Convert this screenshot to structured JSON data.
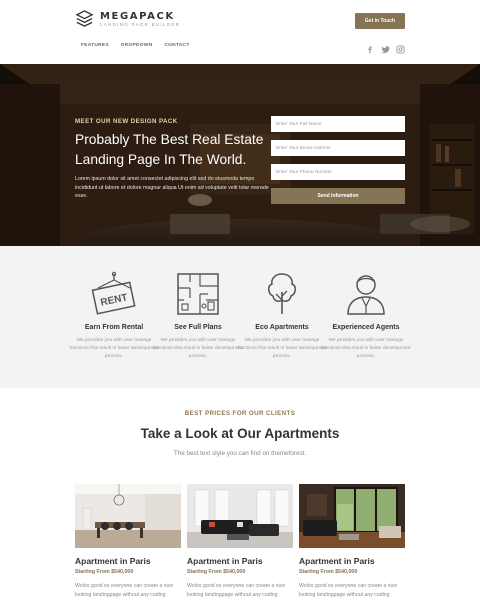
{
  "header": {
    "logo_name": "MEGAPACK",
    "logo_tagline": "LANDING PAGE BUILDER",
    "cta_label": "Get in Touch",
    "nav": [
      "FEATURES",
      "DROPDOWN",
      "CONTACT"
    ],
    "social_icons": [
      "facebook-icon",
      "twitter-icon",
      "instagram-icon"
    ]
  },
  "hero": {
    "eyebrow": "MEET OUR NEW DESIGN PACK",
    "title": "Probably The Best Real Estate Landing Page In The World.",
    "text": "Lorem ipsum dolor sit amet consectet adipiscing elit sed do eiusmoda tempo incididunt ut labore et dolore magnar aliqua Ut enim ad voluptate velit tolar merade esse.",
    "form": {
      "name_placeholder": "Enter Your Full Name",
      "email_placeholder": "Enter Your Email Address",
      "phone_placeholder": "Enter Your Phone Number",
      "submit_label": "Send Information"
    }
  },
  "features": [
    {
      "icon": "rent-sign-icon",
      "title": "Earn From Rental",
      "desc": "We provides you with user manage functions that result in faster development process."
    },
    {
      "icon": "floor-plan-icon",
      "title": "See Full Plans",
      "desc": "We provides you with user manage functions that result in faster development process."
    },
    {
      "icon": "tree-icon",
      "title": "Eco Apartments",
      "desc": "We provides you with user manage functions that result in faster development process."
    },
    {
      "icon": "agent-icon",
      "title": "Experienced Agents",
      "desc": "We provides you with user manage functions that result in faster development process."
    }
  ],
  "apartments": {
    "eyebrow": "BEST PRICES FOR OUR CLIENTS",
    "title": "Take a Look at Our Apartments",
    "desc": "The best text style you can find on themeforest.",
    "cards": [
      {
        "title": "Apartment in Paris",
        "price": "Starting From $540,000",
        "desc": "Works good so everyone can create a nice looking landingpage without any coding knowledge at all that result in"
      },
      {
        "title": "Apartment in Paris",
        "price": "Starting From $540,000",
        "desc": "Works good so everyone can create a nice looking landingpage without any coding knowledge at all that result in"
      },
      {
        "title": "Apartment in Paris",
        "price": "Starting From $540,000",
        "desc": "Works good so everyone can create a nice looking landingpage without any coding knowledge at all that result in"
      }
    ]
  },
  "colors": {
    "accent": "#857554",
    "accent_text": "#8c7a52",
    "features_bg": "#f3f3f3"
  }
}
